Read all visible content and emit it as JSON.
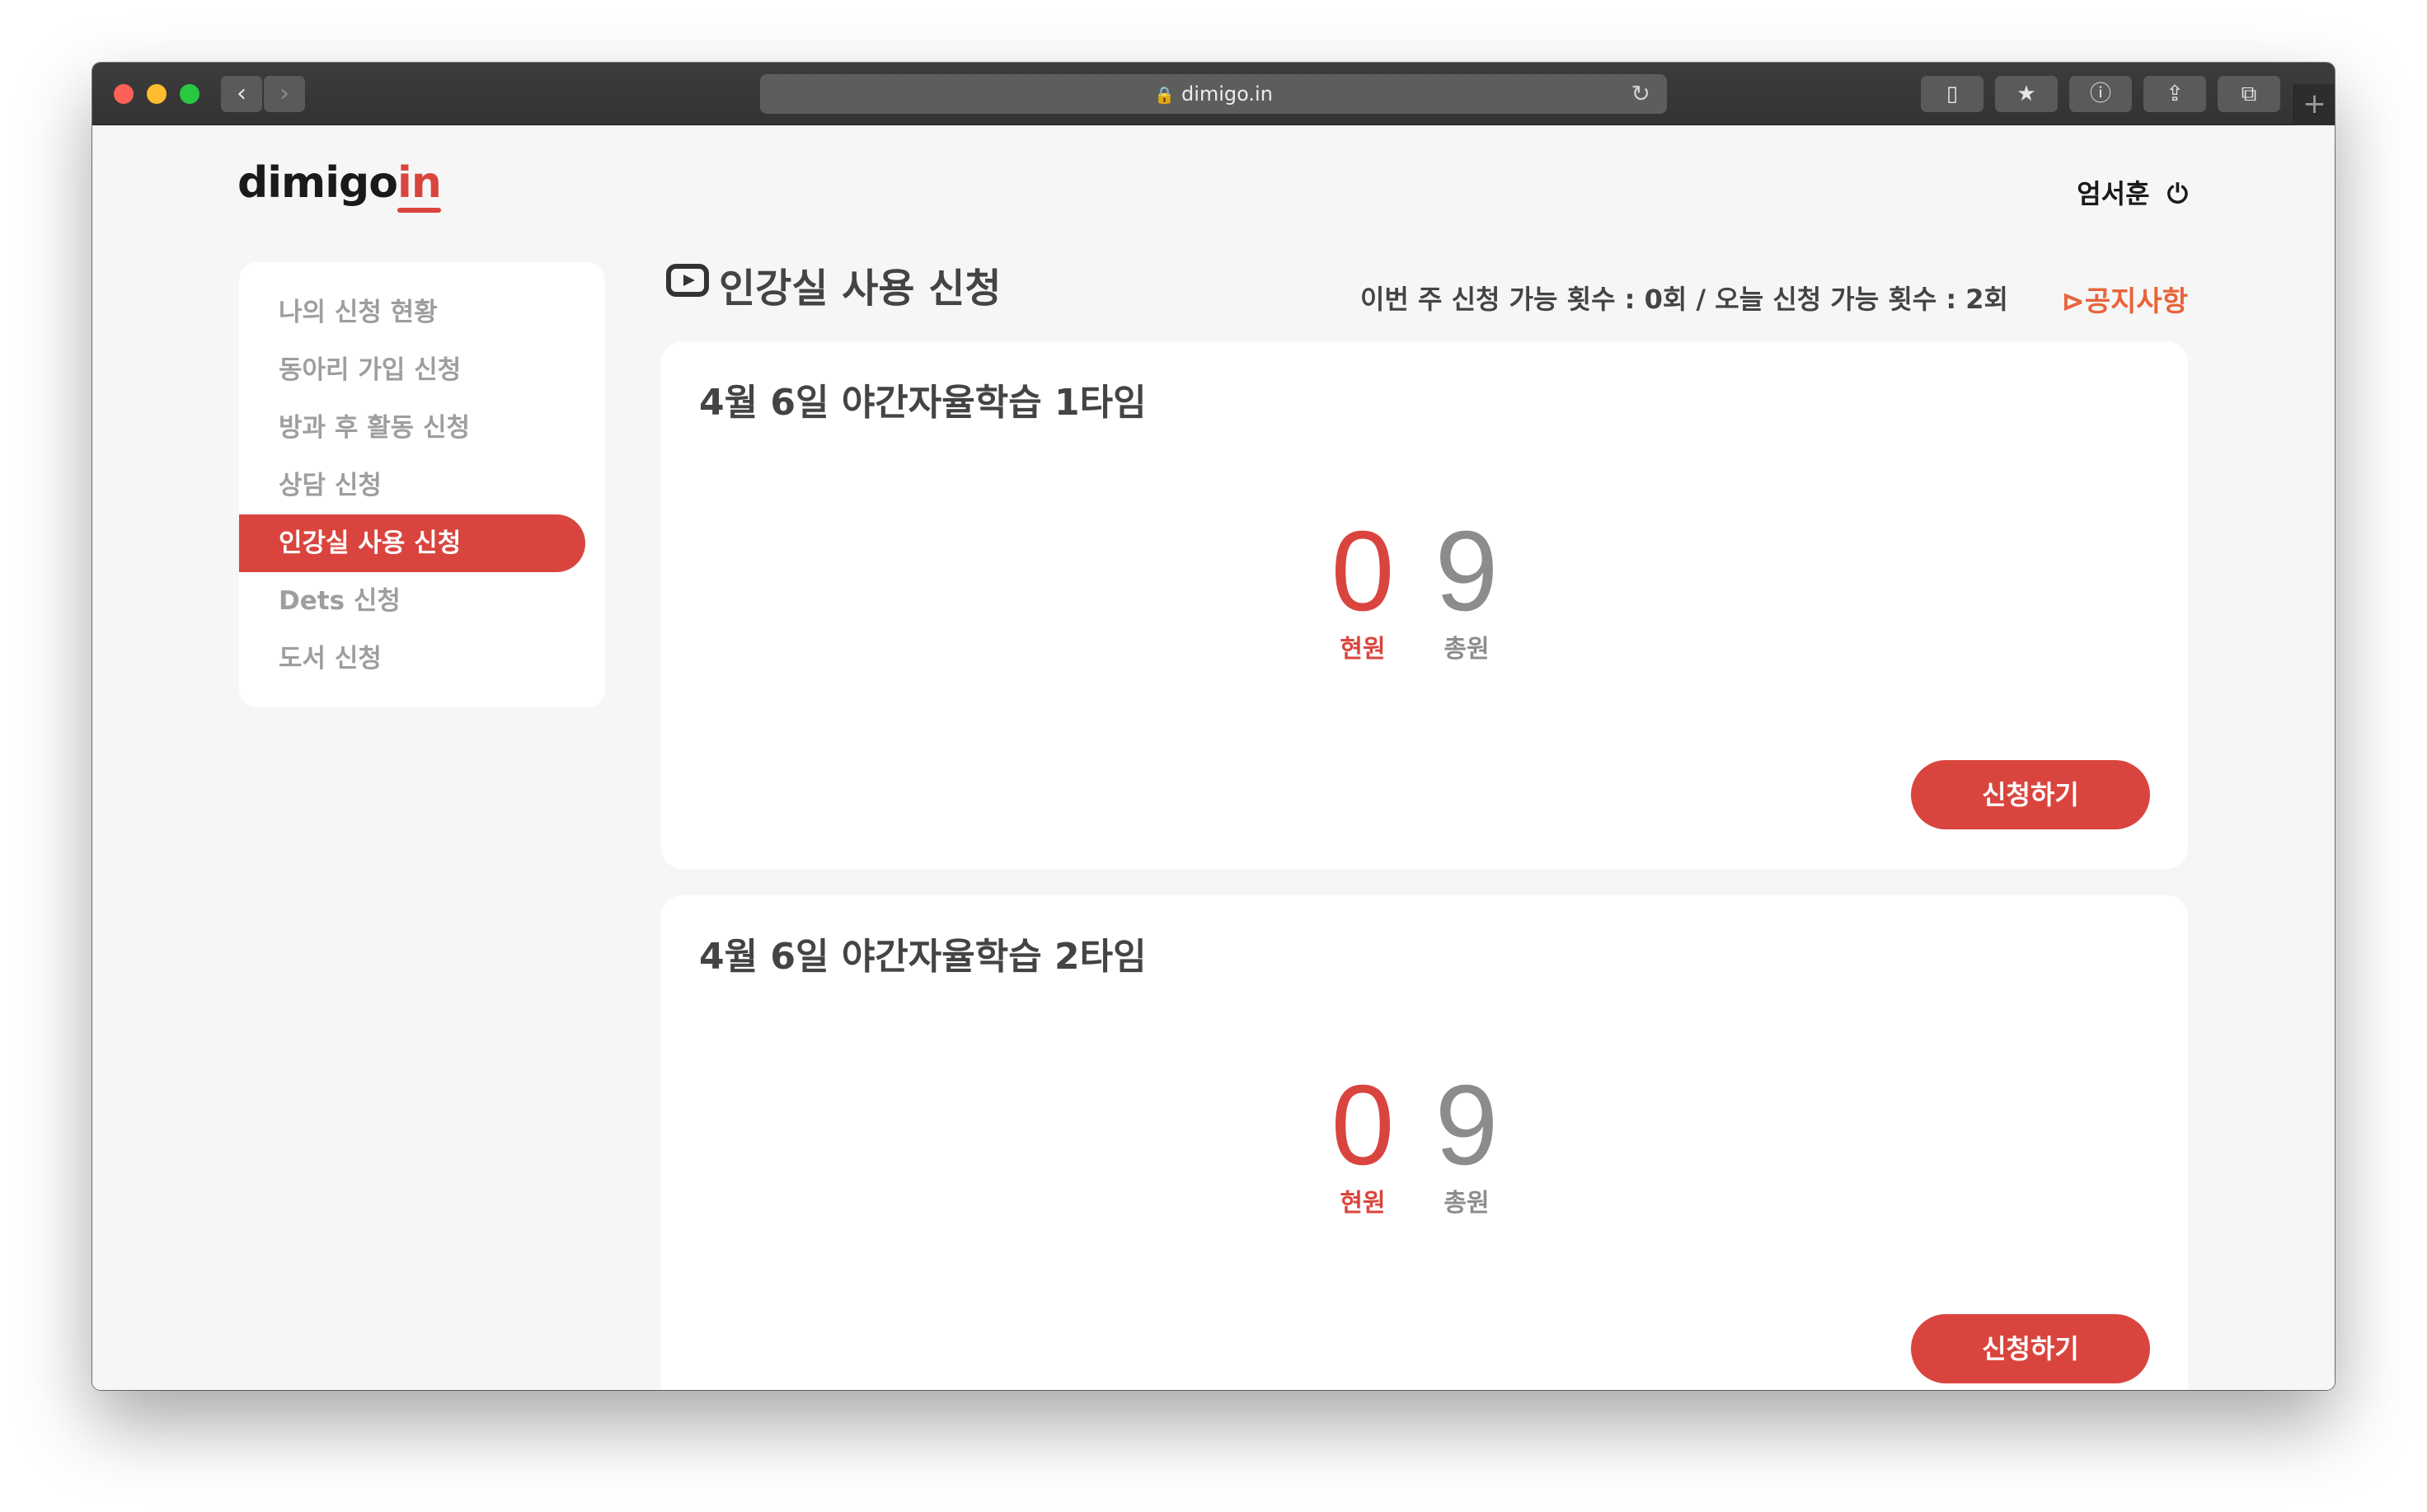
{
  "browser": {
    "url": "dimigo.in",
    "icons": {
      "back": "chevron-left-icon",
      "forward": "chevron-right-icon",
      "lock": "lock-icon",
      "reload": "reload-icon",
      "sidebar": "sidebar-icon",
      "bookmark": "star-icon",
      "info": "info-icon",
      "share": "share-icon",
      "tabs": "tabs-icon",
      "new_tab": "plus-icon"
    }
  },
  "header": {
    "logo_main": "dimigo",
    "logo_accent": "in",
    "user_name": "엄서훈"
  },
  "sidebar": {
    "items": [
      {
        "label": "나의 신청 현황",
        "active": false
      },
      {
        "label": "동아리 가입 신청",
        "active": false
      },
      {
        "label": "방과 후 활동 신청",
        "active": false
      },
      {
        "label": "상담 신청",
        "active": false
      },
      {
        "label": "인강실 사용 신청",
        "active": true
      },
      {
        "label": "Dets 신청",
        "active": false
      },
      {
        "label": "도서 신청",
        "active": false
      }
    ]
  },
  "main": {
    "title": "인강실 사용 신청",
    "quota_text": "이번 주 신청 가능 횟수 : 0회 / 오늘 신청 가능 횟수 : 2회",
    "notice_label": "공지사항",
    "cards": [
      {
        "title": "4월 6일 야간자율학습 1타임",
        "current": "0",
        "current_label": "현원",
        "total": "9",
        "total_label": "총원",
        "button": "신청하기"
      },
      {
        "title": "4월 6일 야간자율학습 2타임",
        "current": "0",
        "current_label": "현원",
        "total": "9",
        "total_label": "총원",
        "button": "신청하기"
      }
    ]
  },
  "colors": {
    "accent": "#d9453e",
    "notice": "#e8643a",
    "background": "#f6f6f6"
  }
}
